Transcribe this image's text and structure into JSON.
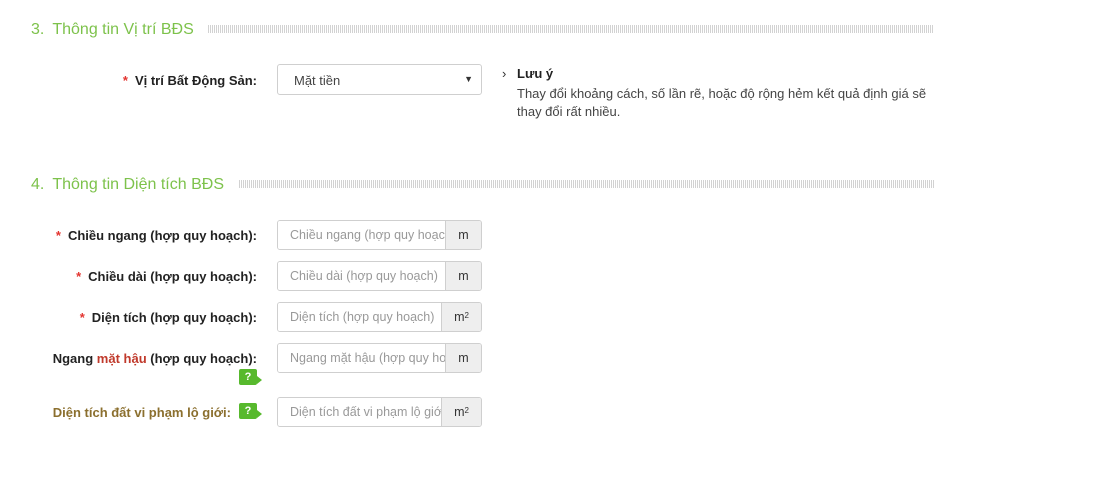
{
  "section3": {
    "number": "3.",
    "title": "Thông tin Vị trí BĐS",
    "location_label": "Vị trí Bất Động Sản:",
    "location_value": "Mặt tiền",
    "note": {
      "heading": "Lưu ý",
      "body": "Thay đổi khoảng cách, số lần rẽ, hoặc độ rộng hẻm kết quả định giá sẽ thay đổi rất nhiều."
    }
  },
  "section4": {
    "number": "4.",
    "title": "Thông tin Diện tích BĐS",
    "fields": [
      {
        "label": "Chiều ngang (hợp quy hoạch):",
        "placeholder": "Chiều ngang (hợp quy hoạch)",
        "unit": "m"
      },
      {
        "label": "Chiều dài (hợp quy hoạch):",
        "placeholder": "Chiều dài (hợp quy hoạch)",
        "unit": "m"
      },
      {
        "label": "Diện tích (hợp quy hoạch):",
        "placeholder": "Diện tích (hợp quy hoạch)",
        "unit": "m",
        "unit_sup": "2"
      },
      {
        "label_pre": "Ngang",
        "label_em": "mặt hậu",
        "label_post": "(hợp quy hoạch):",
        "placeholder": "Ngang mặt hậu (hợp quy hoạch)",
        "unit": "m"
      },
      {
        "label": "Diện tích đất vi phạm lộ giới:",
        "placeholder": "Diện tích đất vi phạm lộ giới",
        "unit": "m",
        "unit_sup": "2"
      }
    ],
    "help_label": "?"
  },
  "required_mark": "*",
  "colors": {
    "section_title": "#7dc24b",
    "required": "#e3342f",
    "help_badge": "#57b92d"
  }
}
